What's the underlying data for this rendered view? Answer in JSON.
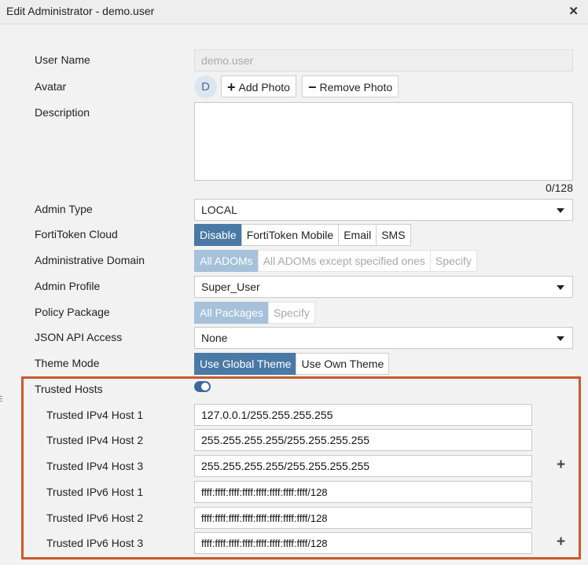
{
  "window": {
    "title": "Edit Administrator - demo.user",
    "close_icon": "close-icon"
  },
  "form": {
    "user_name": {
      "label": "User Name",
      "value": "demo.user"
    },
    "avatar": {
      "label": "Avatar",
      "initial": "D",
      "add_photo": "Add Photo",
      "remove_photo": "Remove Photo"
    },
    "description": {
      "label": "Description",
      "value": "",
      "counter": "0/128"
    },
    "admin_type": {
      "label": "Admin Type",
      "value": "LOCAL"
    },
    "forti_token": {
      "label": "FortiToken Cloud",
      "options": [
        "Disable",
        "FortiToken Mobile",
        "Email",
        "SMS"
      ],
      "selected": "Disable"
    },
    "admin_domain": {
      "label": "Administrative Domain",
      "options": [
        "All ADOMs",
        "All ADOMs except specified ones",
        "Specify"
      ],
      "selected": "All ADOMs"
    },
    "admin_profile": {
      "label": "Admin Profile",
      "value": "Super_User"
    },
    "policy_package": {
      "label": "Policy Package",
      "options": [
        "All Packages",
        "Specify"
      ],
      "selected": "All Packages"
    },
    "json_api": {
      "label": "JSON API Access",
      "value": "None"
    },
    "theme_mode": {
      "label": "Theme Mode",
      "options": [
        "Use Global Theme",
        "Use Own Theme"
      ],
      "selected": "Use Global Theme"
    },
    "trusted_hosts": {
      "label": "Trusted Hosts",
      "enabled": true,
      "hosts": [
        {
          "label": "Trusted IPv4 Host 1",
          "value": "127.0.0.1/255.255.255.255"
        },
        {
          "label": "Trusted IPv4 Host 2",
          "value": "255.255.255.255/255.255.255.255"
        },
        {
          "label": "Trusted IPv4 Host 3",
          "value": "255.255.255.255/255.255.255.255"
        },
        {
          "label": "Trusted IPv6 Host 1",
          "value": "ffff:ffff:ffff:ffff:ffff:ffff:ffff:ffff/128"
        },
        {
          "label": "Trusted IPv6 Host 2",
          "value": "ffff:ffff:ffff:ffff:ffff:ffff:ffff:ffff/128"
        },
        {
          "label": "Trusted IPv6 Host 3",
          "value": "ffff:ffff:ffff:ffff:ffff:ffff:ffff:ffff/128"
        }
      ]
    }
  },
  "colors": {
    "accent": "#4a79a5",
    "accent_disabled": "#a6c1da",
    "highlight": "#c95a2c"
  }
}
